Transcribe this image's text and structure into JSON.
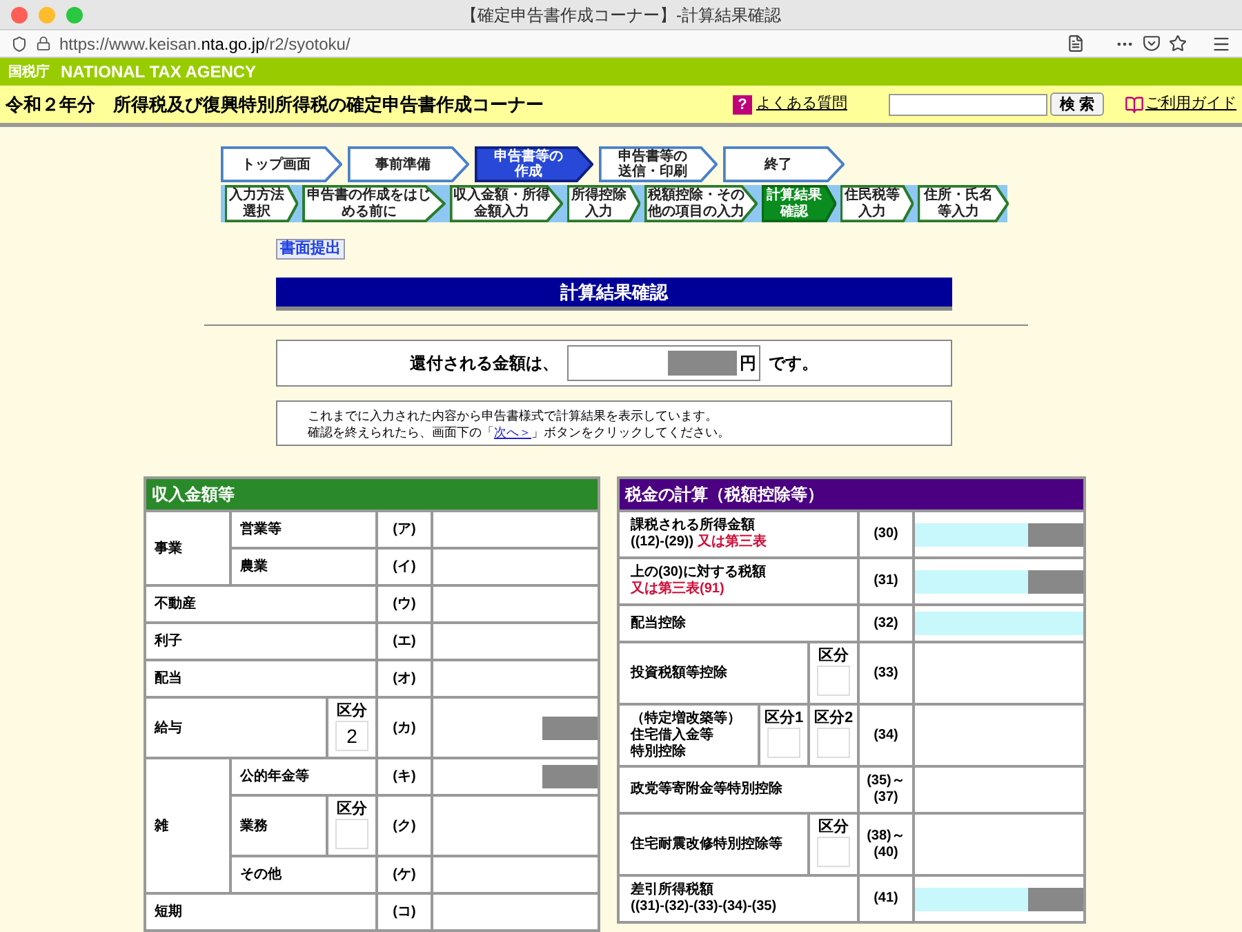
{
  "browser": {
    "title": "【確定申告書作成コーナー】-計算結果確認",
    "url_prefix": "https://www.keisan.",
    "url_domain": "nta.go.jp",
    "url_path": "/r2/syotoku/"
  },
  "header": {
    "agency_jp": "国税庁",
    "agency_en": "NATIONAL TAX AGENCY",
    "corner_title": "令和２年分　所得税及び復興特別所得税の確定申告書作成コーナー",
    "faq_icon": "?",
    "faq_link": "よくある質問",
    "search_button": "検 索",
    "guide_link": "ご利用ガイド"
  },
  "main_steps": [
    {
      "label": "トップ画面",
      "selected": false
    },
    {
      "label": "事前準備",
      "selected": false
    },
    {
      "label": "申告書等の作成",
      "selected": true
    },
    {
      "label": "申告書等の送信・印刷",
      "selected": false
    },
    {
      "label": "終了",
      "selected": false
    }
  ],
  "sub_steps": [
    {
      "label": "入力方法選択",
      "selected": false
    },
    {
      "label": "申告書の作成をはじめる前に",
      "selected": false
    },
    {
      "label": "収入金額・所得金額入力",
      "selected": false
    },
    {
      "label": "所得控除入力",
      "selected": false
    },
    {
      "label": "税額控除・その他の項目の入力",
      "selected": false
    },
    {
      "label": "計算結果確認",
      "selected": true
    },
    {
      "label": "住民税等入力",
      "selected": false
    },
    {
      "label": "住所・氏名等入力",
      "selected": false
    }
  ],
  "paper_button": "書面提出",
  "page_heading": "計算結果確認",
  "refund": {
    "prefix": "還付される金額は、",
    "masked": true,
    "unit": "円",
    "suffix": "です。"
  },
  "notice": {
    "line1": "これまでに入力された内容から申告書様式で計算結果を表示しています。",
    "line2_before": "確認を終えられたら、画面下の「",
    "link": "次へ＞",
    "line2_after": "」ボタンをクリックしてください。"
  },
  "income": {
    "title": "収入金額等",
    "groups": [
      {
        "label": "事業",
        "rows": [
          {
            "label": "営業等",
            "code": "(ア)",
            "value": {
              "shaded": false,
              "masked": false
            }
          },
          {
            "label": "農業",
            "code": "(イ)",
            "value": {
              "shaded": false,
              "masked": false
            }
          }
        ]
      },
      {
        "rows": [
          {
            "label": "不動産",
            "code": "(ウ)",
            "value": {
              "shaded": false,
              "masked": false
            }
          }
        ]
      },
      {
        "rows": [
          {
            "label": "利子",
            "code": "(エ)",
            "value": {
              "shaded": false,
              "masked": false
            }
          }
        ]
      },
      {
        "rows": [
          {
            "label": "配当",
            "code": "(オ)",
            "value": {
              "shaded": false,
              "masked": false
            }
          }
        ]
      },
      {
        "rows": [
          {
            "label": "給与",
            "code": "(カ)",
            "kubun": [
              {
                "label": "区分",
                "value": "2"
              }
            ],
            "value": {
              "shaded": false,
              "masked": true
            }
          }
        ]
      },
      {
        "label": "雑",
        "rows": [
          {
            "label": "公的年金等",
            "code": "(キ)",
            "value": {
              "shaded": false,
              "masked": true
            }
          },
          {
            "label": "業務",
            "code": "(ク)",
            "kubun": [
              {
                "label": "区分"
              }
            ],
            "value": {
              "shaded": false,
              "masked": false
            }
          },
          {
            "label": "その他",
            "code": "(ケ)",
            "value": {
              "shaded": false,
              "masked": false
            }
          }
        ]
      },
      {
        "rows": [
          {
            "label": "短期",
            "code": "(コ)",
            "value": {
              "shaded": false,
              "masked": false
            }
          }
        ]
      }
    ]
  },
  "tax": {
    "title": "税金の計算（税額控除等）",
    "rows": [
      {
        "lines": [
          {
            "text": "課税される所得金額"
          },
          {
            "text": "((12)-(29))",
            "note": "又は第三表"
          }
        ],
        "code": "(30)",
        "value": {
          "shaded": true,
          "masked": true
        }
      },
      {
        "lines": [
          {
            "text": "上の(30)に対する税額"
          },
          {
            "note": "又は第三表(91)"
          }
        ],
        "code": "(31)",
        "value": {
          "shaded": true,
          "masked": true
        }
      },
      {
        "lines": [
          {
            "text": "配当控除"
          }
        ],
        "code": "(32)",
        "value": {
          "shaded": true,
          "masked": false
        }
      },
      {
        "lines": [
          {
            "text": "投資税額等控除"
          }
        ],
        "code": "(33)",
        "kubun": [
          {
            "label": "区分"
          }
        ],
        "value": {
          "shaded": false,
          "masked": false
        }
      },
      {
        "lines": [
          {
            "text": "（特定増改築等）"
          },
          {
            "text": "住宅借入金等"
          },
          {
            "text": "特別控除"
          }
        ],
        "code": "(34)",
        "kubun": [
          {
            "label": "区分1"
          },
          {
            "label": "区分2"
          }
        ],
        "value": {
          "shaded": false,
          "masked": false
        }
      },
      {
        "lines": [
          {
            "text": "政党等寄附金等特別控除"
          }
        ],
        "code": "(35)～(37)",
        "value": {
          "shaded": false,
          "masked": false
        }
      },
      {
        "lines": [
          {
            "text": "住宅耐震改修特別控除等"
          }
        ],
        "code": "(38)～(40)",
        "kubun": [
          {
            "label": "区分"
          }
        ],
        "value": {
          "shaded": false,
          "masked": false
        }
      },
      {
        "lines": [
          {
            "text": "差引所得税額"
          },
          {
            "text": "((31)-(32)-(33)-(34)-(35)"
          }
        ],
        "code": "(41)",
        "value": {
          "shaded": true,
          "masked": true
        }
      }
    ]
  }
}
